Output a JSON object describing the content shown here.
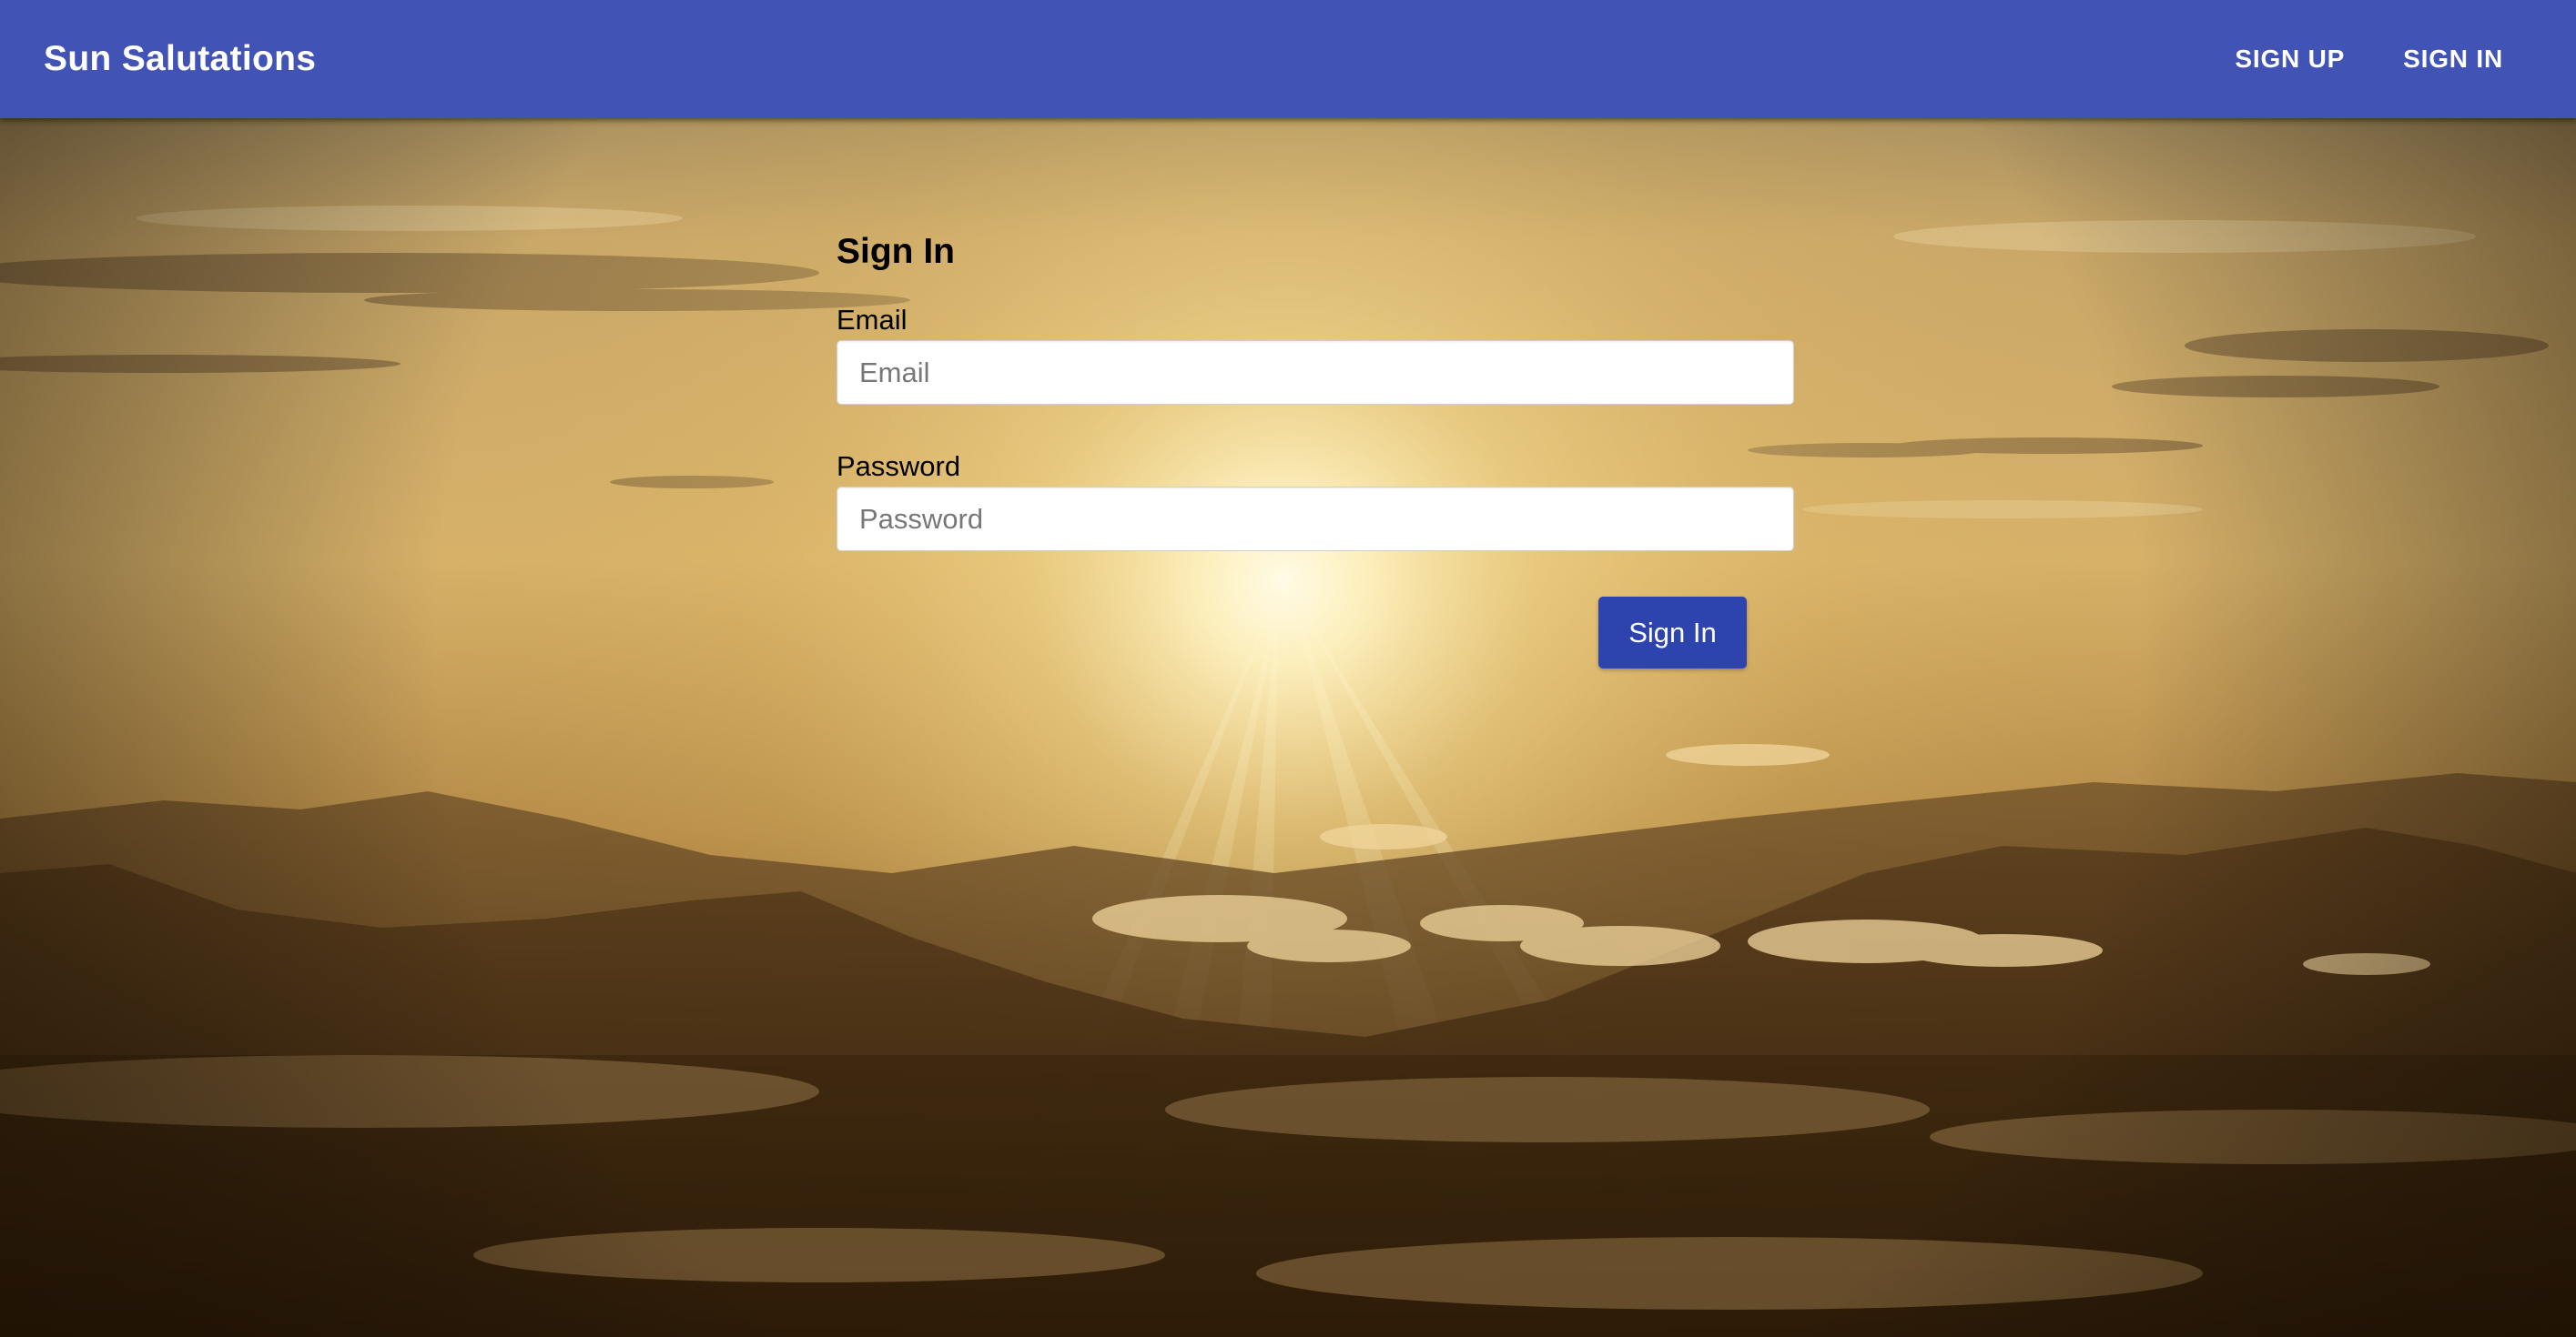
{
  "header": {
    "brand": "Sun Salutations",
    "nav": [
      {
        "label": "SIGN UP"
      },
      {
        "label": "SIGN IN"
      }
    ]
  },
  "form": {
    "title": "Sign In",
    "email": {
      "label": "Email",
      "placeholder": "Email"
    },
    "password": {
      "label": "Password",
      "placeholder": "Password"
    },
    "submit_label": "Sign In"
  },
  "colors": {
    "appbar": "#4153b4",
    "button": "#2d44ae"
  }
}
